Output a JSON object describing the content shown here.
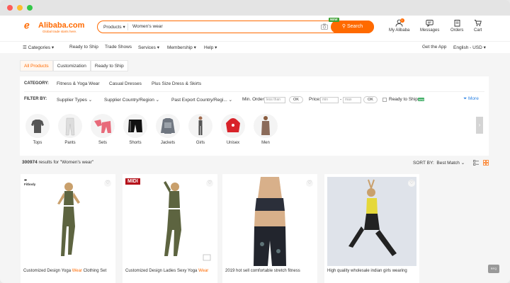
{
  "window": {
    "title": ""
  },
  "header": {
    "logo_text": "Alibaba.com",
    "logo_tagline": "Global trade starts here.",
    "search_category": "Products",
    "search_value": "Women's wear",
    "search_button": "Search",
    "new_badge": "NEW",
    "my_alibaba_label": "My Alibaba",
    "my_alibaba_count": "1",
    "messages_label": "Messages",
    "orders_label": "Orders",
    "cart_label": "Cart"
  },
  "nav": {
    "categories": "Categories",
    "ready_to_ship": "Ready to Ship",
    "trade_shows": "Trade Shows",
    "services": "Services",
    "membership": "Membership",
    "help": "Help",
    "get_app": "Get the App",
    "language_currency": "English - USD"
  },
  "tabs": [
    "All Products",
    "Customization",
    "Ready to Ship"
  ],
  "filters": {
    "category_label": "CATEGORY:",
    "categories": [
      "Fitness & Yoga Wear",
      "Casual Dresses",
      "Plus Size Dress & Skirts"
    ],
    "filter_by_label": "FILTER BY:",
    "supplier_types": "Supplier Types",
    "supplier_region": "Supplier Country/Region",
    "export_region": "Past Export Country/Regi...",
    "min_order_label": "Min. Order:",
    "min_order_placeholder": "less than",
    "ok": "OK",
    "price_label": "Price:",
    "price_min_placeholder": "min",
    "price_dash": "-",
    "price_max_placeholder": "max",
    "ready_to_ship": "Ready to Ship",
    "ready_tag": "new",
    "more": "More"
  },
  "category_icons": [
    "Tops",
    "Pants",
    "Sets",
    "Shorts",
    "Jackets",
    "Girls",
    "Unisex",
    "Men"
  ],
  "results": {
    "count": "300974",
    "text": "results for \"Women's wear\"",
    "sort_label": "SORT BY:",
    "sort_value": "Best Match"
  },
  "products": [
    {
      "brand": "Fitbody",
      "title_prefix": "Customized Design Yoga ",
      "title_highlight": "Wear",
      "title_suffix": " Clothing Set"
    },
    {
      "brand": "MIDI",
      "title_prefix": "Customized Design Ladies Sexy Yoga ",
      "title_highlight": "Wear",
      "title_suffix": ""
    },
    {
      "brand": "",
      "title_prefix": "2019 hot sell comfortable stretch fitness",
      "title_highlight": "",
      "title_suffix": ""
    },
    {
      "brand": "",
      "title_prefix": "High quality wholesale indian girls wearing",
      "title_highlight": "",
      "title_suffix": ""
    }
  ],
  "footer_badge": "RFQ",
  "colors": {
    "accent": "#ff6a00",
    "link": "#2a82e4",
    "green": "#3fa136"
  }
}
